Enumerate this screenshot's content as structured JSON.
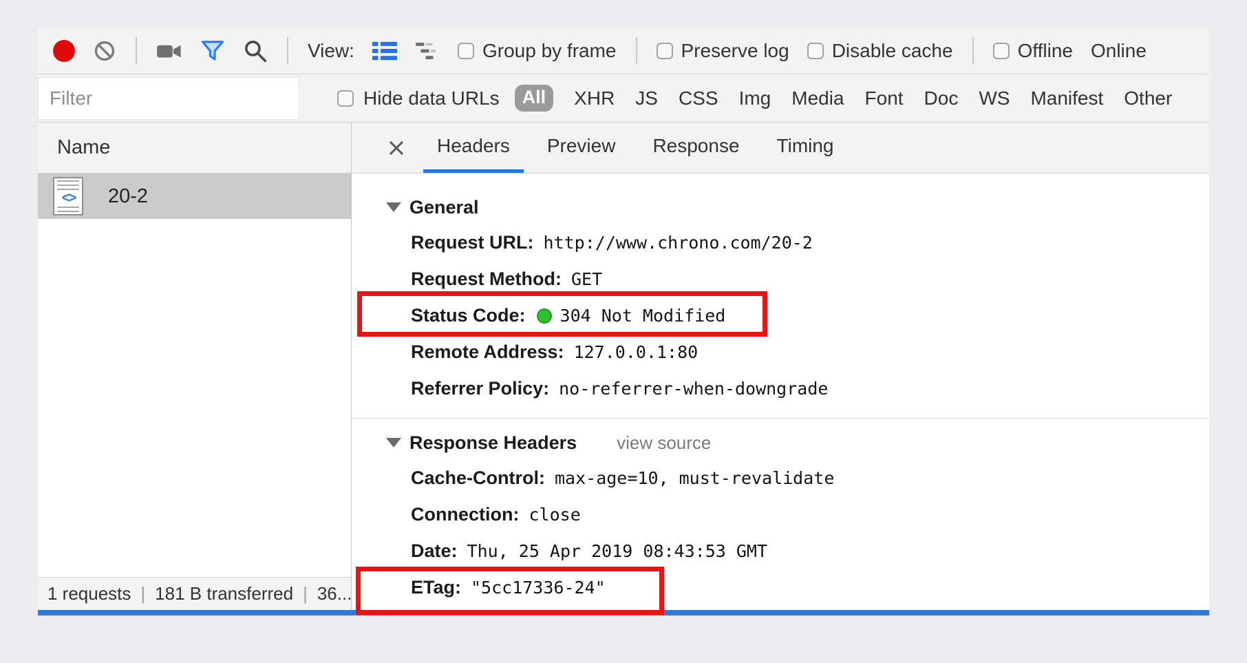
{
  "toolbar": {
    "view_label": "View:",
    "group_by_frame": "Group by frame",
    "preserve_log": "Preserve log",
    "disable_cache": "Disable cache",
    "offline_label": "Offline",
    "online_label": "Online"
  },
  "filter_bar": {
    "filter_placeholder": "Filter",
    "hide_data_urls_label": "Hide data URLs",
    "type_filters": [
      "All",
      "XHR",
      "JS",
      "CSS",
      "Img",
      "Media",
      "Font",
      "Doc",
      "WS",
      "Manifest",
      "Other"
    ]
  },
  "request_list": {
    "name_header": "Name",
    "rows": [
      {
        "name": "20-2",
        "icon_glyph": "<>"
      }
    ],
    "summary": {
      "requests": "1 requests",
      "separator": "|",
      "transferred": "181 B transferred",
      "truncated": "36..."
    }
  },
  "detail": {
    "tabs": [
      {
        "label": "Headers"
      },
      {
        "label": "Preview"
      },
      {
        "label": "Response"
      },
      {
        "label": "Timing"
      }
    ],
    "general": {
      "title": "General",
      "rows": [
        {
          "label": "Request URL:",
          "value": "http://www.chrono.com/20-2"
        },
        {
          "label": "Request Method:",
          "value": "GET"
        },
        {
          "label": "Status Code:",
          "value": "304 Not Modified"
        },
        {
          "label": "Remote Address:",
          "value": "127.0.0.1:80"
        },
        {
          "label": "Referrer Policy:",
          "value": "no-referrer-when-downgrade"
        }
      ]
    },
    "response_headers": {
      "title": "Response Headers",
      "action": "view source",
      "rows": [
        {
          "label": "Cache-Control:",
          "value": "max-age=10, must-revalidate"
        },
        {
          "label": "Connection:",
          "value": "close"
        },
        {
          "label": "Date:",
          "value": "Thu, 25 Apr 2019 08:43:53 GMT"
        },
        {
          "label": "ETag:",
          "value": "\"5cc17336-24\""
        }
      ]
    }
  },
  "colors": {
    "accent_blue": "#1f76dd",
    "highlight_red": "#ea1212",
    "status_green": "#2fbf30",
    "record_red": "#df0b0b",
    "bottom_line_blue": "#2e7cd6"
  }
}
